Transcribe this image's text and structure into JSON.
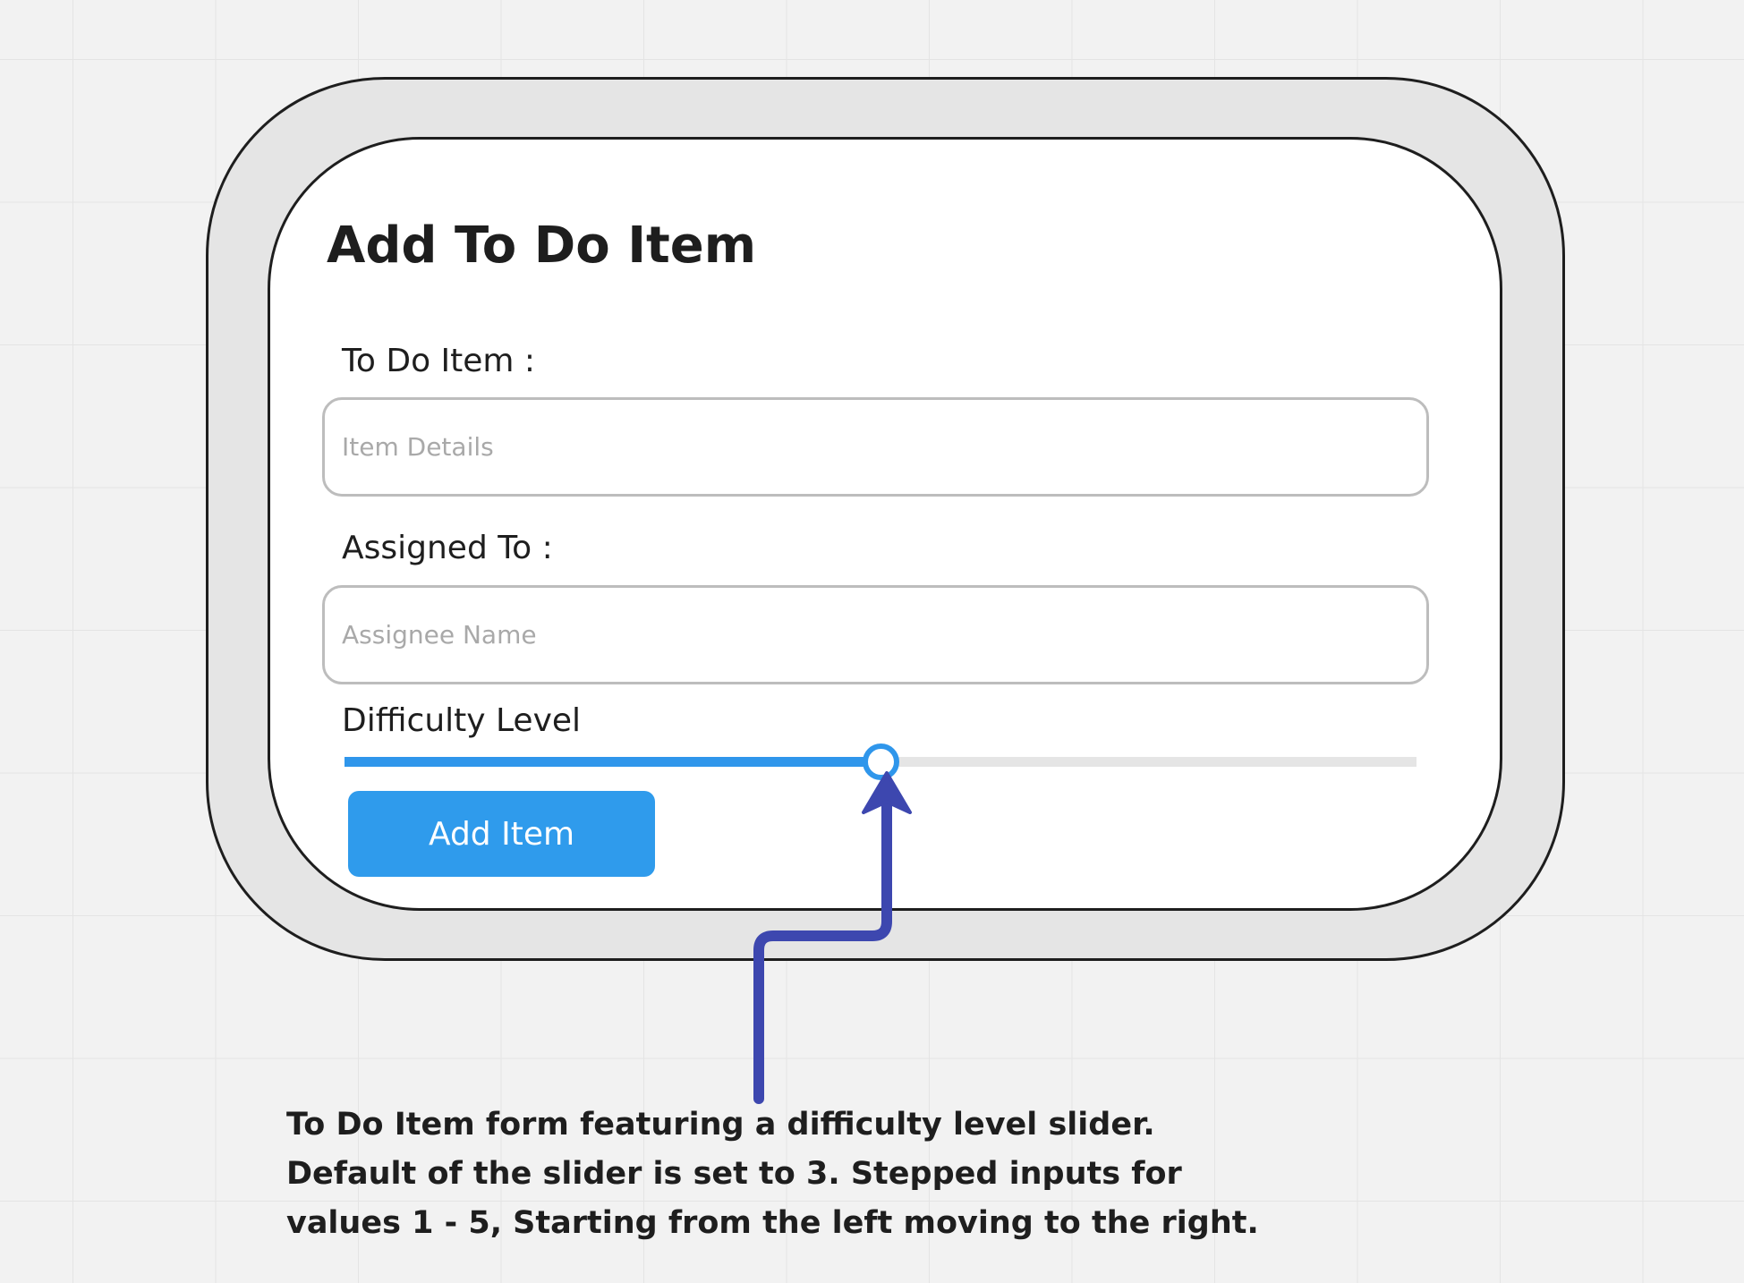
{
  "form": {
    "title": "Add To Do Item",
    "item_field": {
      "label": "To Do Item :",
      "placeholder": "Item Details",
      "value": ""
    },
    "assignee_field": {
      "label": "Assigned To :",
      "placeholder": "Assignee Name",
      "value": ""
    },
    "difficulty": {
      "label": "Difficulty Level",
      "min": 1,
      "max": 5,
      "step": 1,
      "value": 3,
      "fill_color": "#2f96eb",
      "track_color": "#e5e5e5"
    },
    "submit_label": "Add Item",
    "accent_color": "#2f9bec"
  },
  "annotation": {
    "text": "To Do Item form featuring a difficulty level slider.\nDefault of the slider is set to 3. Stepped inputs for\nvalues 1 - 5, Starting from the left moving to the right.",
    "arrow_color": "#3d47af"
  }
}
